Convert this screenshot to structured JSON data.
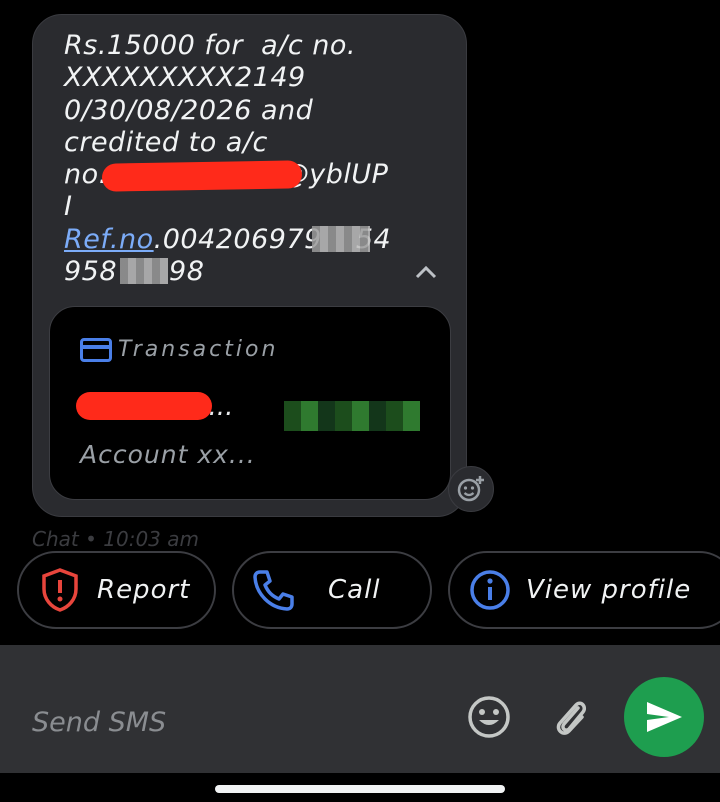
{
  "message": {
    "line1": "Rs.15000 for  a/c no.",
    "line2": "XXXXXXXXX2149",
    "line3": "0/30/08/2026 and",
    "line4": "credited to a/c",
    "line5_prefix": "no.",
    "line5_suffix": "@yblUP",
    "line6": "I",
    "ref_link": "Ref.no",
    "ref_value": ".004206979",
    "ref_tail": "54",
    "line8_start": "958",
    "line8_end": "98"
  },
  "transaction": {
    "title": "Transaction",
    "name": "2...",
    "account": "Account xx..."
  },
  "timestamp": "Chat • 10:03 am",
  "actions": {
    "report": "Report",
    "call": "Call",
    "view_profile": "View profile"
  },
  "composer": {
    "placeholder": "Send SMS"
  },
  "colors": {
    "accent_blue": "#4a7fe8",
    "report_red": "#e8453c",
    "send_green": "#1e9e4f",
    "redaction_red": "#ff2a1a"
  },
  "icons": [
    "chevron-up-icon",
    "card-icon",
    "add-reaction-icon",
    "shield-alert-icon",
    "phone-icon",
    "info-icon",
    "emoji-icon",
    "paperclip-icon",
    "send-icon"
  ]
}
